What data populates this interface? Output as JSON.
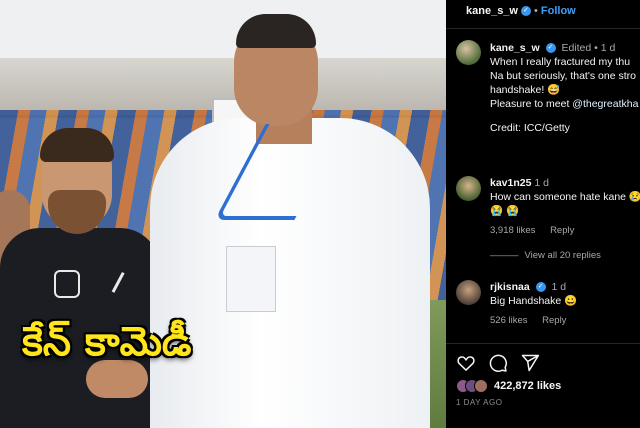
{
  "caption": "కేన్ కామెడీ",
  "post": {
    "username": "kane_s_w",
    "follow_label": "Follow",
    "caption_user": "kane_s_w",
    "edited": "Edited",
    "age": "1 d",
    "caption_lines": [
      "When I really fractured my thu",
      "Na but seriously, that's one stro",
      "handshake! 😅",
      "Pleasure to meet ",
      "Credit: ICC/Getty"
    ],
    "mention": "@thegreatkha"
  },
  "comments": [
    {
      "user": "kav1n25",
      "age": "1 d",
      "text": "How can someone hate kane 😢",
      "emoji_line": "😭 😭",
      "likes": "3,918 likes",
      "reply": "Reply",
      "view_replies": "View all 20 replies"
    },
    {
      "user": "rjkisnaa",
      "age": "1 d",
      "text": "Big Handshake 😀",
      "likes": "526 likes",
      "reply": "Reply"
    }
  ],
  "footer": {
    "likes_count": "422,872 likes",
    "date": "1 DAY AGO"
  },
  "colors": {
    "caption_yellow": "#ffe51a",
    "follow_blue": "#3ea0f5",
    "verified_blue": "#3897f0",
    "panel_bg": "#000000"
  },
  "icons": [
    "heart-icon",
    "comment-icon",
    "share-icon",
    "verified-badge-icon"
  ]
}
